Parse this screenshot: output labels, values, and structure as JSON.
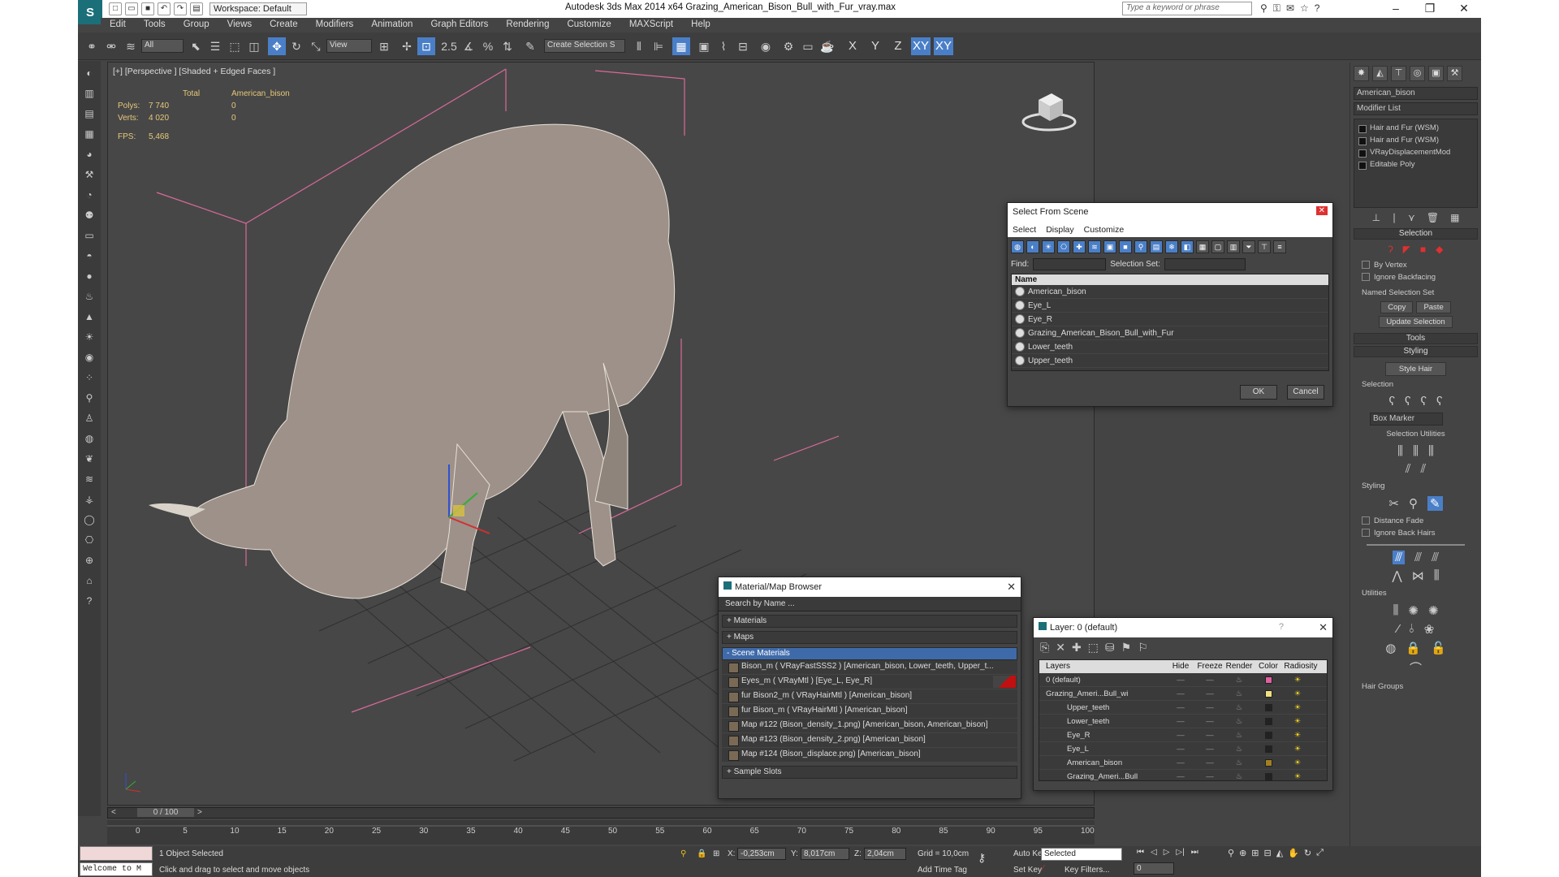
{
  "titlebar": {
    "workspace": "Workspace: Default",
    "title": "Autodesk 3ds Max  2014 x64    Grazing_American_Bison_Bull_with_Fur_vray.max",
    "search_placeholder": "Type a keyword or phrase"
  },
  "menu": [
    "Edit",
    "Tools",
    "Group",
    "Views",
    "Create",
    "Modifiers",
    "Animation",
    "Graph Editors",
    "Rendering",
    "Customize",
    "MAXScript",
    "Help"
  ],
  "toolbar": {
    "filter": "All",
    "refcoord": "View",
    "selset": "Create Selection S",
    "snap_angle": "2.5",
    "axes": [
      "X",
      "Y",
      "Z",
      "XY",
      "XY"
    ]
  },
  "viewport": {
    "label": "[+] [Perspective ] [Shaded + Edged Faces ]",
    "stats": {
      "total_label": "Total",
      "object": "American_bison",
      "polys_label": "Polys:",
      "polys_total": "7 740",
      "polys_obj": "0",
      "verts_label": "Verts:",
      "verts_total": "4 020",
      "verts_obj": "0",
      "fps_label": "FPS:",
      "fps": "5,468"
    }
  },
  "command_panel": {
    "object_name": "American_bison",
    "modifier_list": "Modifier List",
    "stack": [
      "Hair and Fur (WSM)",
      "Hair and Fur (WSM)",
      "VRayDisplacementMod",
      "Editable Poly"
    ],
    "selection_title": "Selection",
    "by_vertex": "By Vertex",
    "ignore_backfacing": "Ignore Backfacing",
    "named_sel": "Named Selection Set",
    "copy": "Copy",
    "paste": "Paste",
    "update_selection": "Update Selection",
    "tools": "Tools",
    "styling": "Styling",
    "style_hair": "Style Hair",
    "selection_sub": "Selection",
    "box_marker": "Box Marker",
    "selection_utilities": "Selection Utilities",
    "styling_sub": "Styling",
    "distance_fade": "Distance Fade",
    "ignore_back_hairs": "Ignore Back Hairs",
    "utilities": "Utilities",
    "hair_groups": "Hair Groups"
  },
  "select_from_scene": {
    "title": "Select From Scene",
    "menu": [
      "Select",
      "Display",
      "Customize"
    ],
    "find_label": "Find:",
    "selection_set_label": "Selection Set:",
    "name_header": "Name",
    "items": [
      "American_bison",
      "Eye_L",
      "Eye_R",
      "Grazing_American_Bison_Bull_with_Fur",
      "Lower_teeth",
      "Upper_teeth"
    ],
    "ok": "OK",
    "cancel": "Cancel"
  },
  "material_browser": {
    "title": "Material/Map Browser",
    "search": "Search by Name ...",
    "groups": [
      "+ Materials",
      "+ Maps",
      "- Scene Materials",
      "+ Sample Slots"
    ],
    "items": [
      "Bison_m  ( VRayFastSSS2 )  [American_bison, Lower_teeth, Upper_t...",
      "Eyes_m  ( VRayMtl )  [Eye_L, Eye_R]",
      "fur Bison2_m  ( VRayHairMtl )  [American_bison]",
      "fur Bison_m  ( VRayHairMtl )  [American_bison]",
      "Map #122 (Bison_density_1.png)  [American_bison, American_bison]",
      "Map #123 (Bison_density_2.png)  [American_bison]",
      "Map #124 (Bison_displace.png)  [American_bison]"
    ]
  },
  "layer_dialog": {
    "title": "Layer: 0 (default)",
    "help": "?",
    "headers": [
      "Layers",
      "Hide",
      "Freeze",
      "Render",
      "Color",
      "Radiosity"
    ],
    "rows": [
      {
        "name": "0 (default)",
        "color": "#e060a0"
      },
      {
        "name": "Grazing_Ameri...Bull_wi",
        "color": "#f0e080"
      },
      {
        "name": "Upper_teeth",
        "color": "#222222"
      },
      {
        "name": "Lower_teeth",
        "color": "#222222"
      },
      {
        "name": "Eye_R",
        "color": "#222222"
      },
      {
        "name": "Eye_L",
        "color": "#222222"
      },
      {
        "name": "American_bison",
        "color": "#a08020"
      },
      {
        "name": "Grazing_Ameri...Bull",
        "color": "#222222"
      }
    ]
  },
  "timeline": {
    "frame": "0 / 100",
    "ticks": [
      "0",
      "5",
      "10",
      "15",
      "20",
      "25",
      "30",
      "35",
      "40",
      "45",
      "50",
      "55",
      "60",
      "65",
      "70",
      "75",
      "80",
      "85",
      "90",
      "95",
      "100"
    ]
  },
  "status": {
    "maxscript": "Welcome to M",
    "selected": "1 Object Selected",
    "prompt": "Click and drag to select and move objects",
    "x_label": "X:",
    "x": "-0,253cm",
    "y_label": "Y:",
    "y": "8,017cm",
    "z_label": "Z:",
    "z": "2,04cm",
    "grid": "Grid = 10,0cm",
    "add_time_tag": "Add Time Tag",
    "auto_key": "Auto Key",
    "selected_dropdown": "Selected",
    "set_key": "Set Key",
    "key_filters": "Key Filters...",
    "frame_value": "0"
  }
}
